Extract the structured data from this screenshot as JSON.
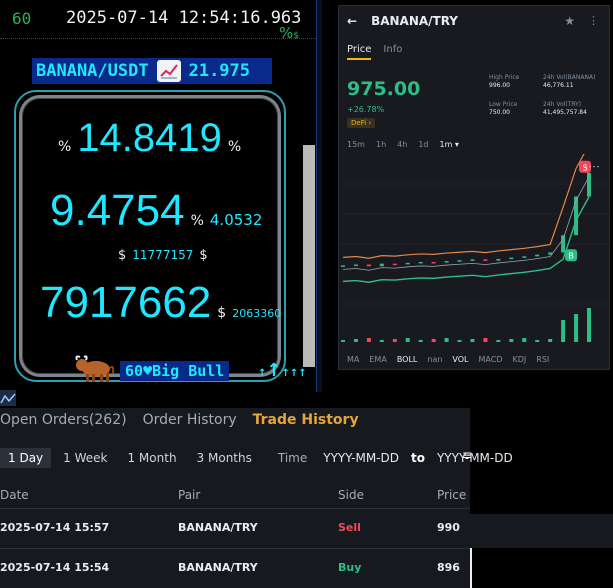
{
  "ticker": {
    "number": "60",
    "timestamp": "2025-07-14 12:54:16.963",
    "mini_pct": "%",
    "mini_dollar": "$",
    "pair": "BANANA/USDT",
    "pair_value": "21.975",
    "pct_unit": "%",
    "pct_value": "14.8419",
    "mid_value": "9.4754",
    "mid_unit": "%",
    "mid_small": "4.0532",
    "vol_unit": "$",
    "vol_value": "11777157",
    "low_value": "7917662",
    "low_unit": "$",
    "low_small": "2063360",
    "bull_count": "60",
    "bull_label": "Big Bull",
    "arrows_big": "↑",
    "arrows_small": "↑↑↑"
  },
  "mobile": {
    "back": "←",
    "pair": "BANANA/TRY",
    "star": "★",
    "share": "⋮",
    "tab_price": "Price",
    "tab_info": "Info",
    "price": "975.00",
    "change": "+26.78%",
    "tag": "DeFi ›",
    "high_label": "High Price",
    "high_value": "996.00",
    "low_label": "Low Price",
    "low_value": "750.00",
    "vol1_label": "24h Vol(BANANA)",
    "vol1_value": "46,776.11",
    "vol2_label": "24h Vol(TRY)",
    "vol2_value": "41,495,757.84",
    "timeframes": [
      "15m",
      "1h",
      "4h",
      "1d",
      "1m ▾"
    ],
    "indicators": [
      "MA",
      "EMA",
      "BOLL",
      "nan",
      "VOL",
      "MACD",
      "KDJ",
      "RSI"
    ]
  },
  "trade": {
    "tabs": [
      "Open Orders(262)",
      "Order History",
      "Trade History"
    ],
    "ranges": [
      "1 Day",
      "1 Week",
      "1 Month",
      "3 Months"
    ],
    "time_label": "Time",
    "date_from": "YYYY-MM-DD",
    "to": "to",
    "date_to": "YYYY-MM-DD",
    "columns": [
      "Date",
      "Pair",
      "Side",
      "Price"
    ],
    "rows": [
      {
        "date": "2025-07-14 15:57",
        "pair": "BANANA/TRY",
        "side": "Sell",
        "price": "990"
      },
      {
        "date": "2025-07-14 15:54",
        "pair": "BANANA/TRY",
        "side": "Buy",
        "price": "896"
      }
    ]
  },
  "colors": {
    "cyan": "#1ee7ff",
    "green": "#2ebd85",
    "red": "#f6465d",
    "gold": "#e4a63a"
  },
  "chart_data": {
    "type": "line",
    "title": "",
    "x": [
      1,
      2,
      3,
      4,
      5,
      6,
      7,
      8,
      9,
      10,
      11,
      12,
      13,
      14,
      15,
      16,
      17,
      18,
      19,
      20
    ],
    "series": [
      {
        "values": [
          760,
          762,
          758,
          764,
          763,
          766,
          768,
          767,
          770,
          772,
          774,
          771,
          775,
          778,
          781,
          785,
          790,
          830,
          920,
          975
        ]
      }
    ],
    "annotations": [
      "S",
      "B"
    ]
  }
}
